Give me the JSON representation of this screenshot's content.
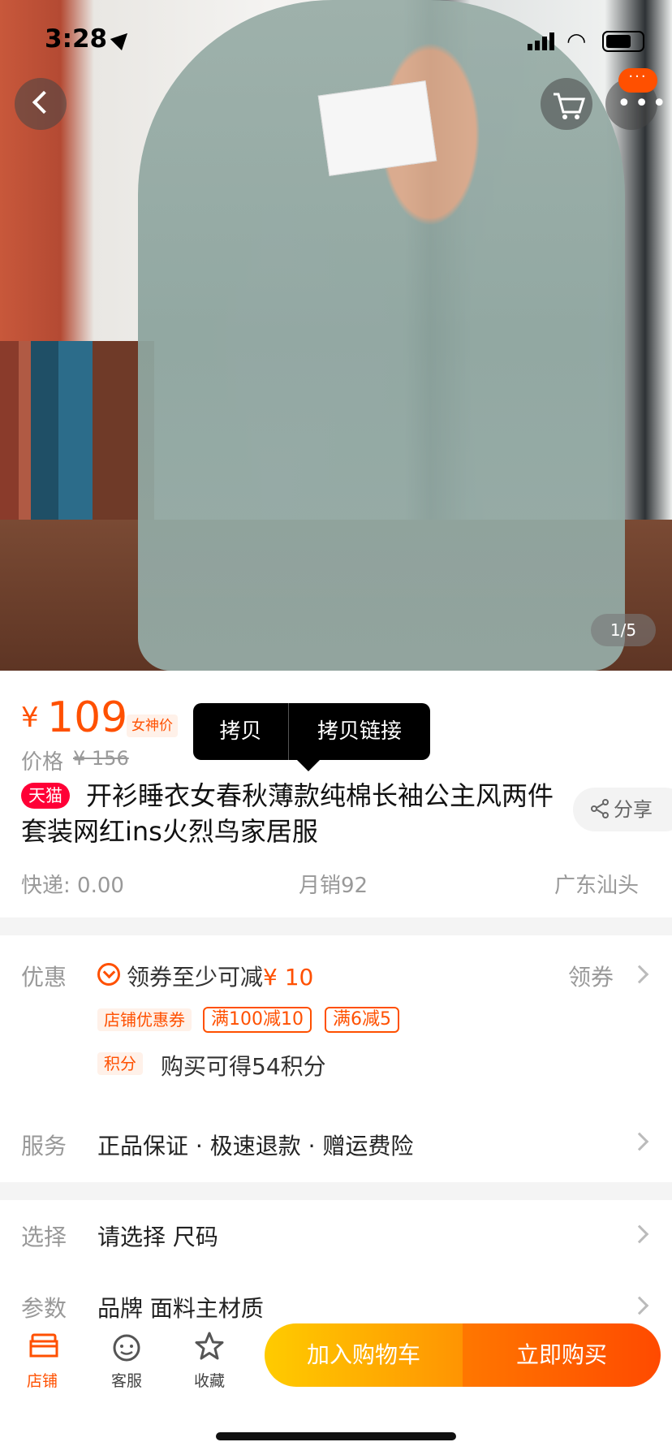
{
  "status_bar": {
    "time": "3:28"
  },
  "gallery": {
    "counter": "1/5",
    "badge": "···"
  },
  "price": {
    "currency": "¥",
    "value": "109",
    "tag": "女神价",
    "orig_label": "价格",
    "orig_price": "¥ 156"
  },
  "tooltip": {
    "copy": "拷贝",
    "copy_link": "拷贝链接"
  },
  "product": {
    "store_tag": "天猫",
    "title": "开衫睡衣女春秋薄款纯棉长袖公主风两件套装网红ins火烈鸟家居服",
    "share": "分享"
  },
  "meta": {
    "shipping": "快递: 0.00",
    "sales": "月销92",
    "location": "广东汕头"
  },
  "promo": {
    "label": "优惠",
    "coupon_text": "领券至少可减",
    "coupon_amount": "¥ 10",
    "get_coupon": "领券",
    "shop_coupon": "店铺优惠券",
    "tickets": [
      "满100减10",
      "满6减5"
    ],
    "points_tag": "积分",
    "points_text": "购买可得54积分"
  },
  "service": {
    "label": "服务",
    "text": "正品保证 · 极速退款 · 赠运费险"
  },
  "select": {
    "label": "选择",
    "text": "请选择 尺码"
  },
  "params": {
    "label": "参数",
    "text": "品牌 面料主材质"
  },
  "bottom_bar": {
    "shop": "店铺",
    "service": "客服",
    "favorite": "收藏",
    "add_cart": "加入购物车",
    "buy_now": "立即购买"
  },
  "colors": {
    "accent": "#ff5000",
    "tmall": "#ff0036"
  }
}
